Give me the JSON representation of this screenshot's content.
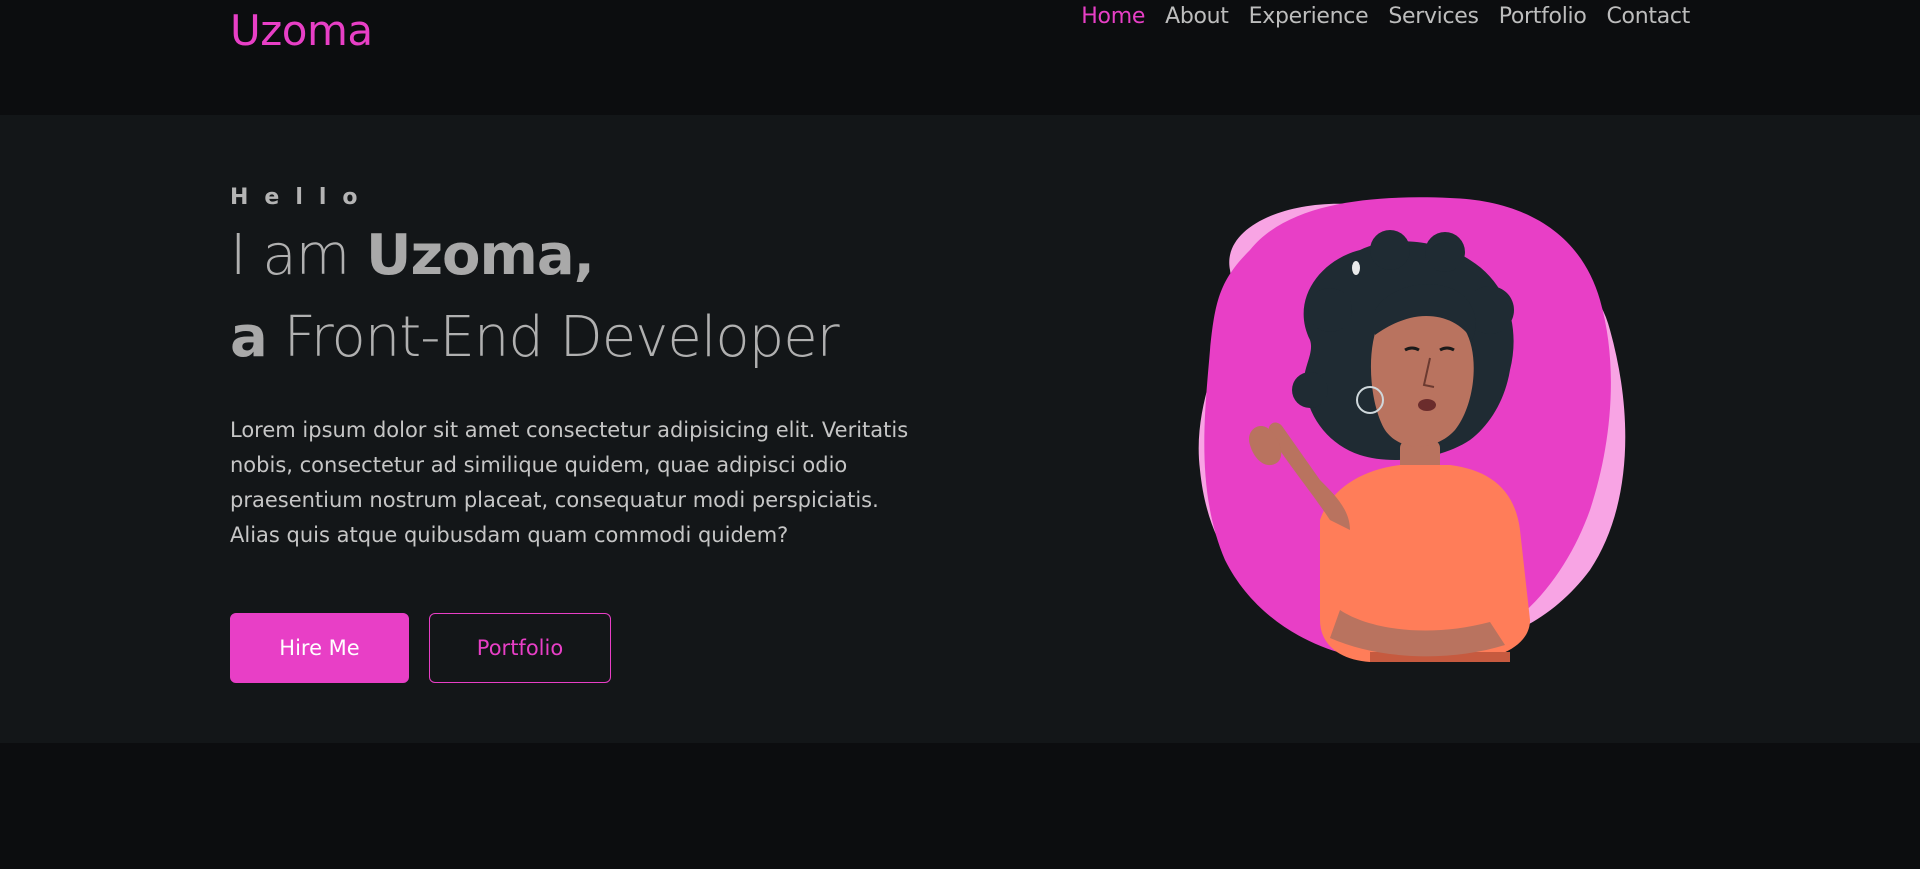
{
  "header": {
    "logo": "Uzoma",
    "nav": [
      {
        "label": "Home",
        "active": true
      },
      {
        "label": "About",
        "active": false
      },
      {
        "label": "Experience",
        "active": false
      },
      {
        "label": "Services",
        "active": false
      },
      {
        "label": "Portfolio",
        "active": false
      },
      {
        "label": "Contact",
        "active": false
      }
    ]
  },
  "hero": {
    "greeting": "Hello",
    "headline_line1_prefix": "I am ",
    "headline_line1_name": "Uzoma,",
    "headline_line2_article": "a",
    "headline_line2_role": " Front-End Developer",
    "description": "Lorem ipsum dolor sit amet consectetur adipisicing elit. Veritatis nobis, consectetur ad similique quidem, quae adipisci odio praesentium nostrum placeat, consequatur modi perspiciatis. Alias quis atque quibusdam quam commodi quidem?",
    "hire_button": "Hire Me",
    "portfolio_button": "Portfolio",
    "illustration": "woman-avatar-illustration"
  },
  "colors": {
    "accent": "#e83fc6",
    "accent_light": "#f8a4e4",
    "background": "#0c0d0f",
    "hero_background": "#131618",
    "text": "#c6c6c6"
  }
}
